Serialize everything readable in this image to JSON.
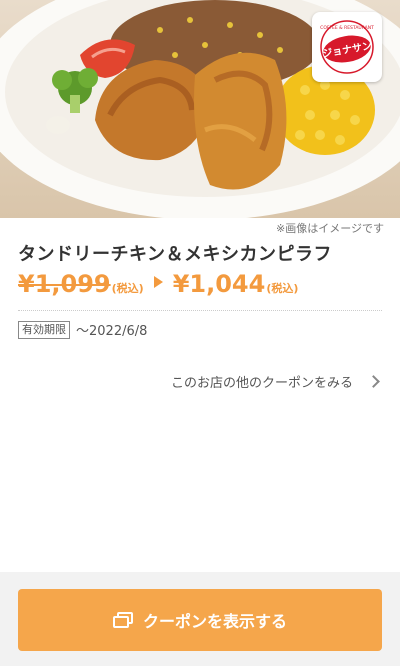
{
  "hero": {
    "image_alt": "dish-photo",
    "logo_text": "ジョナサン",
    "logo_ring_text": "COFFEE & RESTAURANT"
  },
  "note": "※画像はイメージです",
  "coupon": {
    "title": "タンドリーチキン＆メキシカンピラフ",
    "price_old": "¥1,099",
    "tax_old": "(税込)",
    "price_new": "¥1,044",
    "tax_new": "(税込)"
  },
  "validity": {
    "label": "有効期限",
    "date": "〜2022/6/8"
  },
  "more_link": "このお店の他のクーポンをみる",
  "button": {
    "label": "クーポンを表示する"
  },
  "colors": {
    "accent": "#f39a3e",
    "button": "#f5a64b",
    "logo_red": "#d7192b"
  }
}
